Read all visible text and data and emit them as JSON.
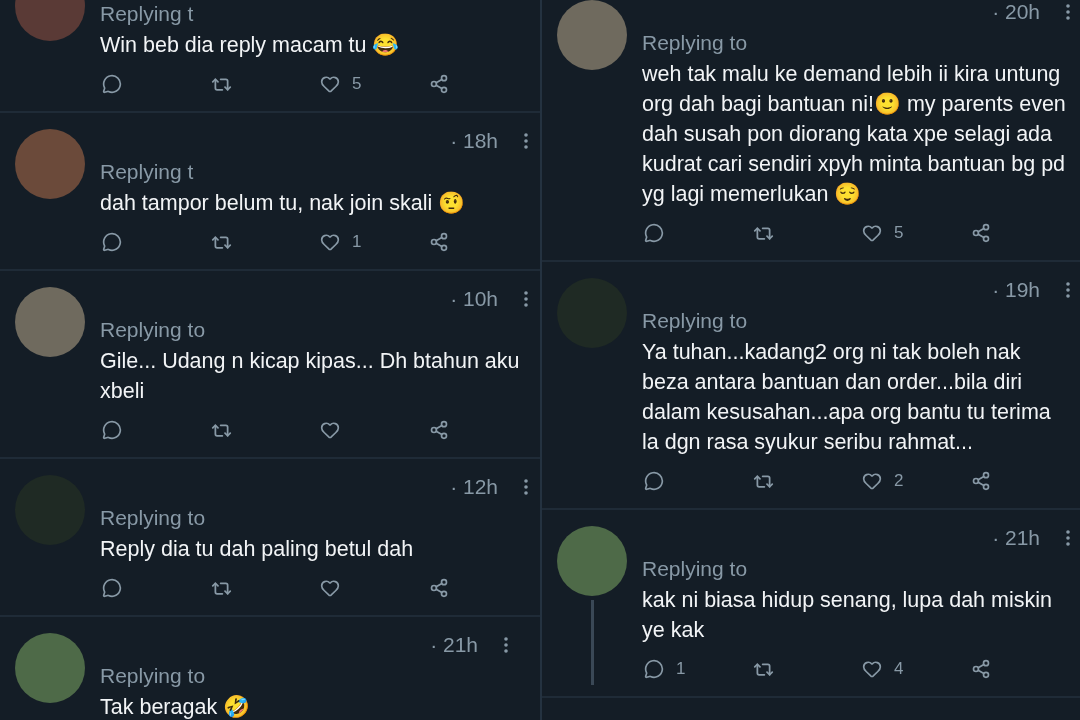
{
  "columns": [
    {
      "tweets": [
        {
          "replying": "Replying t",
          "text": "Win beb dia reply macam tu 😂",
          "likes": "5",
          "threaded": false,
          "actions": true
        },
        {
          "time": "· 18h",
          "replying": "Replying t",
          "text": "dah tampor belum tu, nak join skali 🤨",
          "likes": "1",
          "threaded": false,
          "actions": true
        },
        {
          "time": "· 10h",
          "replying": "Replying to",
          "text": "Gile... Udang n kicap kipas... Dh btahun aku xbeli",
          "threaded": false,
          "actions": true
        },
        {
          "time": "· 12h",
          "replying": "Replying to",
          "text": "Reply dia tu dah paling betul dah",
          "threaded": false,
          "actions": true
        },
        {
          "time": "· 21h",
          "replying": "Replying to",
          "text": "Tak beragak 🤣",
          "threaded": false,
          "actions": false
        }
      ]
    },
    {
      "tweets": [
        {
          "time": "· 20h",
          "replying": "Replying to",
          "text": "weh tak malu ke demand lebih ii kira untung org dah bagi bantuan ni!🙂 my parents even dah susah pon diorang kata xpe selagi ada kudrat cari sendiri xpyh minta bantuan bg pd yg lagi memerlukan 😌",
          "likes": "5",
          "threaded": false,
          "actions": true
        },
        {
          "time": "· 19h",
          "replying": "Replying to",
          "text": "Ya tuhan...kadang2 org ni tak boleh nak beza antara bantuan dan order...bila diri dalam kesusahan...apa org bantu tu terima la dgn rasa syukur seribu rahmat...",
          "likes": "2",
          "threaded": false,
          "actions": true
        },
        {
          "time": "· 21h",
          "replying": "Replying to",
          "text": "kak ni biasa hidup senang, lupa dah miskin ye kak",
          "replies": "1",
          "likes": "4",
          "threaded": true,
          "actions": true
        }
      ]
    }
  ]
}
